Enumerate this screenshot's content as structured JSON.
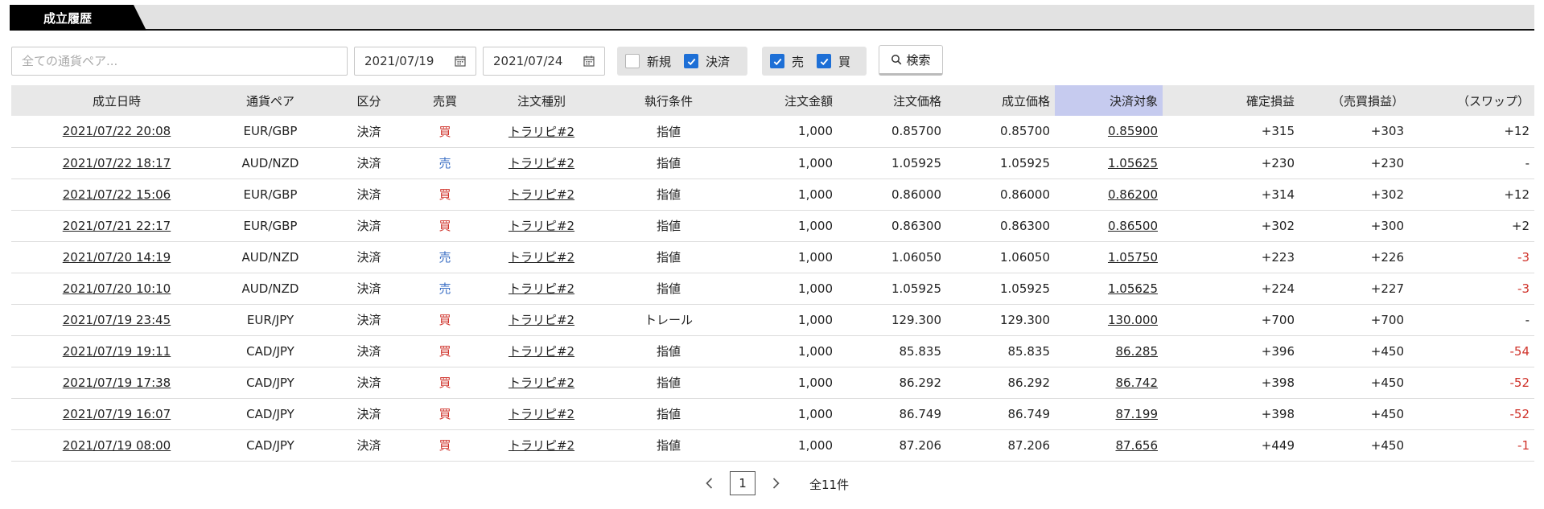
{
  "tab": {
    "label": "成立履歴"
  },
  "filters": {
    "pair_placeholder": "全ての通貨ペア...",
    "date_from": "2021/07/19",
    "date_to": "2021/07/24",
    "new_label": "新規",
    "new_checked": false,
    "settle_label": "決済",
    "settle_checked": true,
    "sell_label": "売",
    "sell_checked": true,
    "buy_label": "買",
    "buy_checked": true,
    "search_label": "検索"
  },
  "table": {
    "headers": [
      "成立日時",
      "通貨ペア",
      "区分",
      "売買",
      "注文種別",
      "執行条件",
      "注文金額",
      "注文価格",
      "成立価格",
      "決済対象",
      "確定損益",
      "（売買損益）",
      "（スワップ）"
    ],
    "rows": [
      [
        "2021/07/22 20:08",
        "EUR/GBP",
        "決済",
        "買",
        "トラリピ#2",
        "指値",
        "1,000",
        "0.85700",
        "0.85700",
        "0.85900",
        "+315",
        "+303",
        "+12"
      ],
      [
        "2021/07/22 18:17",
        "AUD/NZD",
        "決済",
        "売",
        "トラリピ#2",
        "指値",
        "1,000",
        "1.05925",
        "1.05925",
        "1.05625",
        "+230",
        "+230",
        "-"
      ],
      [
        "2021/07/22 15:06",
        "EUR/GBP",
        "決済",
        "買",
        "トラリピ#2",
        "指値",
        "1,000",
        "0.86000",
        "0.86000",
        "0.86200",
        "+314",
        "+302",
        "+12"
      ],
      [
        "2021/07/21 22:17",
        "EUR/GBP",
        "決済",
        "買",
        "トラリピ#2",
        "指値",
        "1,000",
        "0.86300",
        "0.86300",
        "0.86500",
        "+302",
        "+300",
        "+2"
      ],
      [
        "2021/07/20 14:19",
        "AUD/NZD",
        "決済",
        "売",
        "トラリピ#2",
        "指値",
        "1,000",
        "1.06050",
        "1.06050",
        "1.05750",
        "+223",
        "+226",
        "-3"
      ],
      [
        "2021/07/20 10:10",
        "AUD/NZD",
        "決済",
        "売",
        "トラリピ#2",
        "指値",
        "1,000",
        "1.05925",
        "1.05925",
        "1.05625",
        "+224",
        "+227",
        "-3"
      ],
      [
        "2021/07/19 23:45",
        "EUR/JPY",
        "決済",
        "買",
        "トラリピ#2",
        "トレール",
        "1,000",
        "129.300",
        "129.300",
        "130.000",
        "+700",
        "+700",
        "-"
      ],
      [
        "2021/07/19 19:11",
        "CAD/JPY",
        "決済",
        "買",
        "トラリピ#2",
        "指値",
        "1,000",
        "85.835",
        "85.835",
        "86.285",
        "+396",
        "+450",
        "-54"
      ],
      [
        "2021/07/19 17:38",
        "CAD/JPY",
        "決済",
        "買",
        "トラリピ#2",
        "指値",
        "1,000",
        "86.292",
        "86.292",
        "86.742",
        "+398",
        "+450",
        "-52"
      ],
      [
        "2021/07/19 16:07",
        "CAD/JPY",
        "決済",
        "買",
        "トラリピ#2",
        "指値",
        "1,000",
        "86.749",
        "86.749",
        "87.199",
        "+398",
        "+450",
        "-52"
      ],
      [
        "2021/07/19 08:00",
        "CAD/JPY",
        "決済",
        "買",
        "トラリピ#2",
        "指値",
        "1,000",
        "87.206",
        "87.206",
        "87.656",
        "+449",
        "+450",
        "-1"
      ]
    ]
  },
  "pagination": {
    "current_page": "1",
    "total_label": "全11件"
  },
  "colors": {
    "buy": "#d0342c",
    "sell": "#3b6fc4",
    "checkbox": "#1d6fd6",
    "highlight_header": "#c6cbef"
  },
  "icons": {
    "calendar": "calendar-icon",
    "search": "magnifier-icon",
    "prev": "chevron-left-icon",
    "next": "chevron-right-icon",
    "check": "checkmark-icon"
  }
}
